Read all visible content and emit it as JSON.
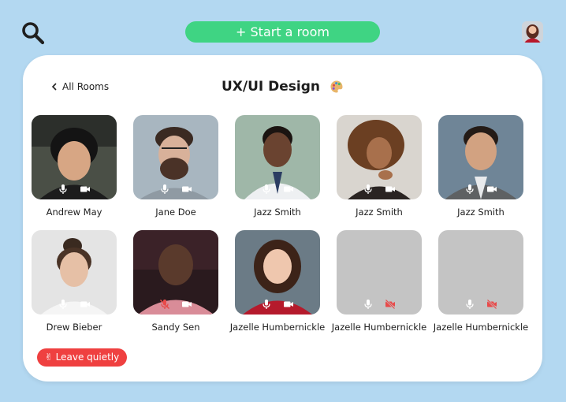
{
  "header": {
    "search_icon": "search-icon",
    "start_room_label": "+ Start a room",
    "avatar_icon": "user-avatar"
  },
  "room": {
    "back_label": "All Rooms",
    "title": "UX/UI Design",
    "title_icon": "palette-icon",
    "leave_label": "Leave quietly",
    "leave_icon": "victory-hand-icon"
  },
  "colors": {
    "background": "#b3d8f1",
    "card": "#ffffff",
    "accent_green": "#3fd483",
    "danger_red": "#ef4040",
    "muted_icon_red": "#e84a4a",
    "placeholder_gray": "#c4c4c4"
  },
  "participants": [
    {
      "name": "Andrew May",
      "mic": "on",
      "camera": "on",
      "video": true
    },
    {
      "name": "Jane Doe",
      "mic": "on",
      "camera": "on",
      "video": true
    },
    {
      "name": "Jazz Smith",
      "mic": "on",
      "camera": "on",
      "video": true
    },
    {
      "name": "Jazz Smith",
      "mic": "on",
      "camera": "on",
      "video": true
    },
    {
      "name": "Jazz Smith",
      "mic": "on",
      "camera": "on",
      "video": true
    },
    {
      "name": "Drew Bieber",
      "mic": "on",
      "camera": "on",
      "video": true
    },
    {
      "name": "Sandy Sen",
      "mic": "off",
      "camera": "on",
      "video": true
    },
    {
      "name": "Jazelle Humbernickle",
      "mic": "on",
      "camera": "on",
      "video": true
    },
    {
      "name": "Jazelle Humbernickle",
      "mic": "on",
      "camera": "off",
      "video": false
    },
    {
      "name": "Jazelle Humbernickle",
      "mic": "on",
      "camera": "off",
      "video": false
    }
  ]
}
